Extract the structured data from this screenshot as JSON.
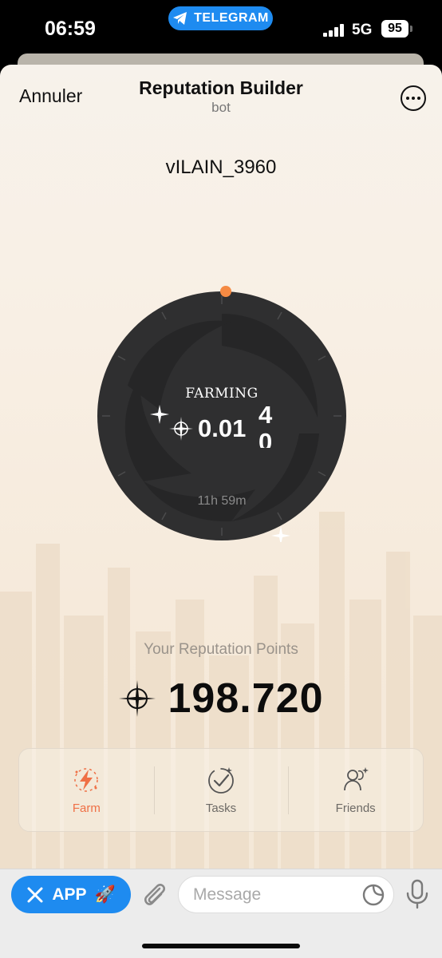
{
  "status_bar": {
    "time": "06:59",
    "app_pill": "TELEGRAM",
    "network": "5G",
    "battery": "95"
  },
  "header": {
    "cancel_label": "Annuler",
    "title": "Reputation Builder",
    "subtitle": "bot",
    "more_icon": "more-horizontal-icon"
  },
  "profile": {
    "username": "vILAIN_3960"
  },
  "farming": {
    "label": "FARMING",
    "value": "0.01",
    "rolling_digits": [
      "4",
      "0"
    ],
    "timer": "11h 59m",
    "progress_fraction": 0.0
  },
  "points": {
    "label": "Your Reputation Points",
    "value": "198.720",
    "icon": "crosshair-star-icon"
  },
  "tabs": [
    {
      "label": "Farm",
      "icon": "farm-lightning-icon",
      "active": true
    },
    {
      "label": "Tasks",
      "icon": "tasks-check-icon",
      "active": false
    },
    {
      "label": "Friends",
      "icon": "friends-icon",
      "active": false
    }
  ],
  "input_bar": {
    "app_button_label": "APP",
    "app_button_emoji": "🚀",
    "message_placeholder": "Message"
  },
  "colors": {
    "telegram_blue": "#1e8bf0",
    "accent_orange": "#ef7046",
    "dial_dark": "#2f2f30"
  }
}
